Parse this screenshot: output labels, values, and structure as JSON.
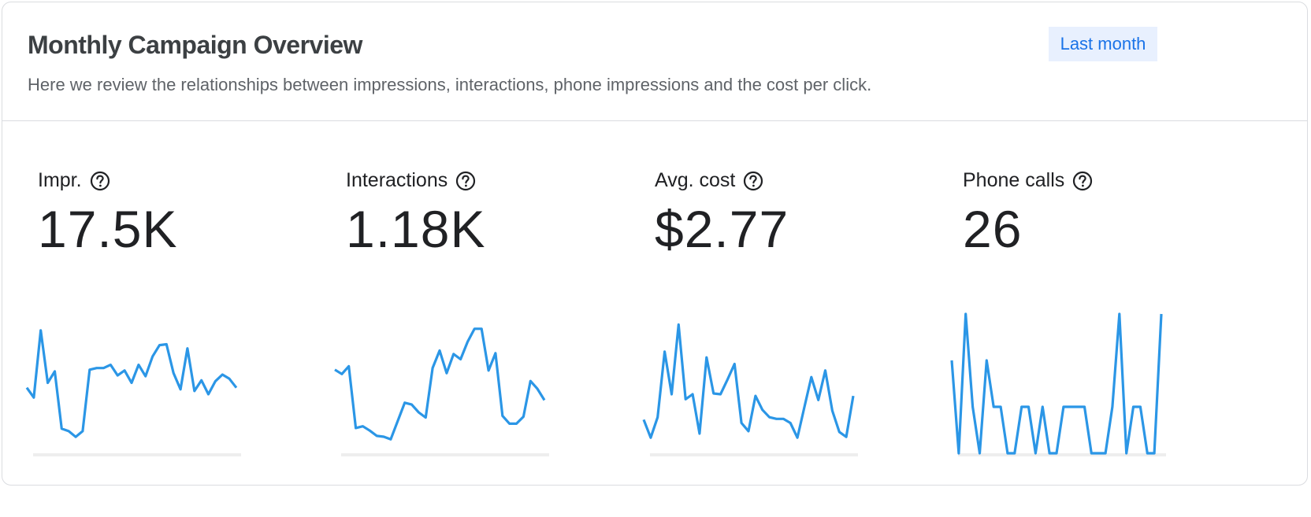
{
  "header": {
    "title": "Monthly Campaign Overview",
    "subtitle": "Here we review the relationships between impressions, interactions, phone impressions and the cost per click.",
    "date_range": "Last month"
  },
  "icons": {
    "help": "help-circle-icon"
  },
  "colors": {
    "line": "#2b96e6",
    "baseline": "#eeeeee",
    "accent": "#1a73e8",
    "chip_bg": "#e8f0fe"
  },
  "metrics": [
    {
      "label": "Impr.",
      "value": "17.5K"
    },
    {
      "label": "Interactions",
      "value": "1.18K"
    },
    {
      "label": "Avg. cost",
      "value": "$2.77"
    },
    {
      "label": "Phone calls",
      "value": "26"
    }
  ],
  "chart_data": [
    {
      "type": "line",
      "name": "Impr.",
      "x": [
        1,
        2,
        3,
        4,
        5,
        6,
        7,
        8,
        9,
        10,
        11,
        12,
        13,
        14,
        15,
        16,
        17,
        18,
        19,
        20,
        21,
        22,
        23,
        24,
        25,
        26,
        27,
        28,
        29,
        30,
        31
      ],
      "values": [
        80,
        68,
        150,
        86,
        100,
        30,
        27,
        20,
        27,
        102,
        104,
        104,
        108,
        95,
        101,
        86,
        108,
        94,
        118,
        132,
        133,
        98,
        78,
        128,
        76,
        89,
        72,
        88,
        96,
        91,
        80
      ],
      "ylim": [
        0,
        170
      ]
    },
    {
      "type": "line",
      "name": "Interactions",
      "x": [
        1,
        2,
        3,
        4,
        5,
        6,
        7,
        8,
        9,
        10,
        11,
        12,
        13,
        14,
        15,
        16,
        17,
        18,
        19,
        20,
        21,
        22,
        23,
        24,
        25,
        26,
        27,
        28,
        29,
        30,
        31
      ],
      "values": [
        96,
        91,
        100,
        29,
        31,
        26,
        20,
        19,
        16,
        37,
        58,
        56,
        47,
        41,
        98,
        118,
        92,
        114,
        108,
        128,
        143,
        143,
        95,
        115,
        43,
        34,
        34,
        42,
        83,
        74,
        61
      ],
      "ylim": [
        0,
        160
      ]
    },
    {
      "type": "line",
      "name": "Avg. cost",
      "x": [
        1,
        2,
        3,
        4,
        5,
        6,
        7,
        8,
        9,
        10,
        11,
        12,
        13,
        14,
        15,
        16,
        17,
        18,
        19,
        20,
        21,
        22,
        23,
        24,
        25,
        26,
        27,
        28,
        29,
        30,
        31
      ],
      "values": [
        4.1,
        1.9,
        4.4,
        12.4,
        7.2,
        15.7,
        6.6,
        7.2,
        2.4,
        11.7,
        7.3,
        7.2,
        9.0,
        10.9,
        3.7,
        2.7,
        7.0,
        5.3,
        4.4,
        4.2,
        4.2,
        3.7,
        1.9,
        5.6,
        9.3,
        6.5,
        10.1,
        5.2,
        2.6,
        2.0,
        7.0
      ],
      "ylim": [
        0,
        17
      ]
    },
    {
      "type": "line",
      "name": "Phone calls",
      "x": [
        1,
        2,
        3,
        4,
        5,
        6,
        7,
        8,
        9,
        10,
        11,
        12,
        13,
        14,
        15,
        16,
        17,
        18,
        19,
        20,
        21,
        22,
        23,
        24,
        25,
        26,
        27,
        28,
        29,
        30,
        31
      ],
      "values": [
        2,
        0,
        3,
        1,
        0,
        2,
        1,
        1,
        0,
        0,
        1,
        1,
        0,
        1,
        0,
        0,
        1,
        1,
        1,
        1,
        0,
        0,
        0,
        1,
        3,
        0,
        1,
        1,
        0,
        0,
        3
      ],
      "ylim": [
        0,
        3
      ]
    }
  ]
}
